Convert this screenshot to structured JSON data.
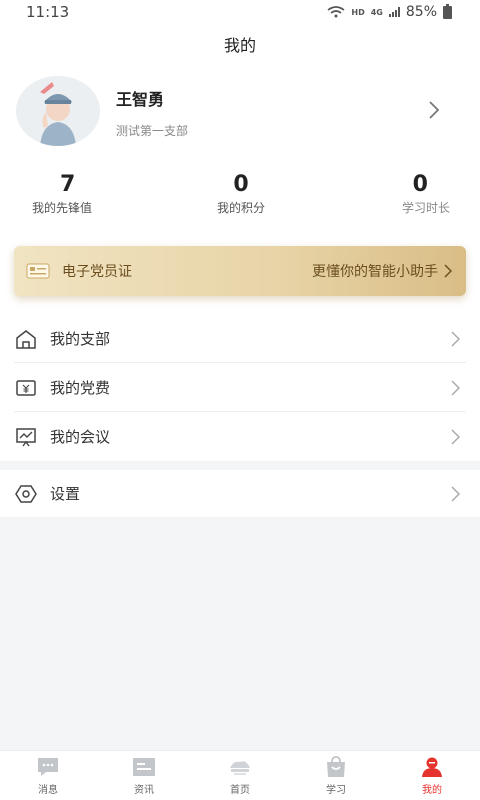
{
  "status_bar": {
    "time": "11:13",
    "network_label": "HD",
    "network_type": "4G",
    "battery": "85%"
  },
  "header": {
    "title": "我的"
  },
  "profile": {
    "name": "王智勇",
    "branch": "测试第一支部"
  },
  "stats": [
    {
      "value": "7",
      "label": "我的先锋值"
    },
    {
      "value": "0",
      "label": "我的积分"
    },
    {
      "value": "0",
      "label": "学习时长"
    }
  ],
  "party_card": {
    "title": "电子党员证",
    "subtitle": "更懂你的智能小助手"
  },
  "menu": [
    {
      "label": "我的支部",
      "icon": "home-icon"
    },
    {
      "label": "我的党费",
      "icon": "yuan-icon"
    },
    {
      "label": "我的会议",
      "icon": "presentation-icon"
    }
  ],
  "settings": {
    "label": "设置",
    "icon": "hexagon-gear-icon"
  },
  "tabbar": {
    "items": [
      {
        "label": "消息",
        "icon": "message-icon"
      },
      {
        "label": "资讯",
        "icon": "news-icon"
      },
      {
        "label": "首页",
        "icon": "home-logo-icon"
      },
      {
        "label": "学习",
        "icon": "study-bag-icon"
      },
      {
        "label": "我的",
        "icon": "profile-icon"
      }
    ],
    "active_index": 4
  },
  "colors": {
    "accent_red": "#e5332e",
    "card_gold": "#e7d3a6",
    "card_text": "#6b4e1f"
  }
}
